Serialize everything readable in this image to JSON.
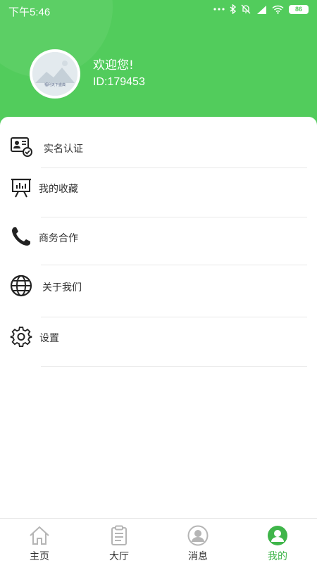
{
  "status_bar": {
    "time": "下午5:46",
    "battery": "86",
    "icons": [
      "dots-icon",
      "bluetooth-icon",
      "mute-bell-icon",
      "cellular-signal-icon",
      "wifi-icon",
      "battery-icon"
    ]
  },
  "profile": {
    "avatar_caption": "福利天下盛典",
    "welcome": "欢迎您!",
    "id": "ID:179453"
  },
  "menu": [
    {
      "label": "实名认证",
      "icon": "id-verify-icon"
    },
    {
      "label": "我的收藏",
      "icon": "presentation-board-icon"
    },
    {
      "label": "商务合作",
      "icon": "phone-icon"
    },
    {
      "label": "关于我们",
      "icon": "globe-icon"
    },
    {
      "label": "设置",
      "icon": "gear-icon"
    }
  ],
  "tabs": [
    {
      "label": "主页",
      "icon": "home-icon",
      "active": false
    },
    {
      "label": "大厅",
      "icon": "clipboard-icon",
      "active": false
    },
    {
      "label": "消息",
      "icon": "user-circle-icon",
      "active": false
    },
    {
      "label": "我的",
      "icon": "user-circle-icon",
      "active": true
    }
  ],
  "colors": {
    "header_green": "#52cc5c",
    "active_tab": "#3fb54a",
    "text": "#333333",
    "inactive_icon": "#b5b5b5"
  }
}
